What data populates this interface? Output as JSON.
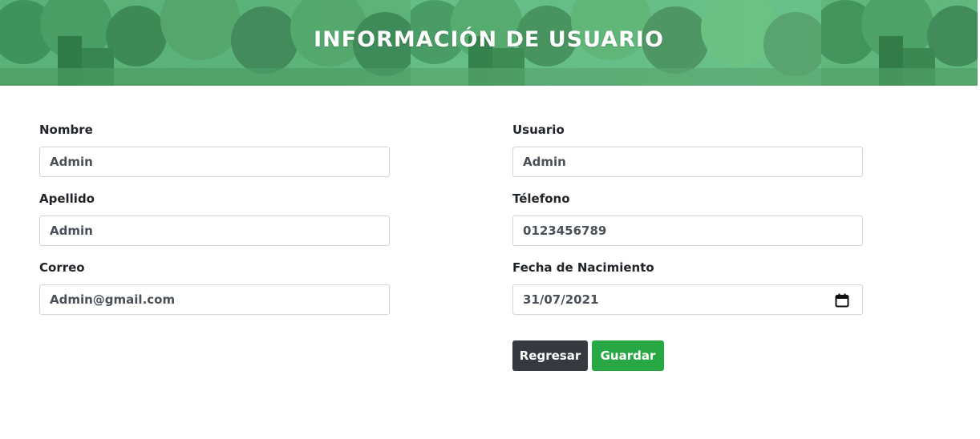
{
  "header": {
    "title": "INFORMACIÓN DE USUARIO"
  },
  "form": {
    "left": [
      {
        "label": "Nombre",
        "value": "Admin"
      },
      {
        "label": "Apellido",
        "value": "Admin"
      },
      {
        "label": "Correo",
        "value": "Admin@gmail.com"
      }
    ],
    "right": [
      {
        "label": "Usuario",
        "value": "Admin"
      },
      {
        "label": "Télefono",
        "value": "0123456789"
      },
      {
        "label": "Fecha de Nacimiento",
        "value": "31/07/2021",
        "icon": "calendar-icon"
      }
    ],
    "buttons": {
      "back_label": "Regresar",
      "save_label": "Guardar"
    }
  },
  "colors": {
    "banner_green": "#5aa872",
    "button_dark": "#343a40",
    "button_green": "#28a745",
    "input_border": "#ced4da"
  }
}
